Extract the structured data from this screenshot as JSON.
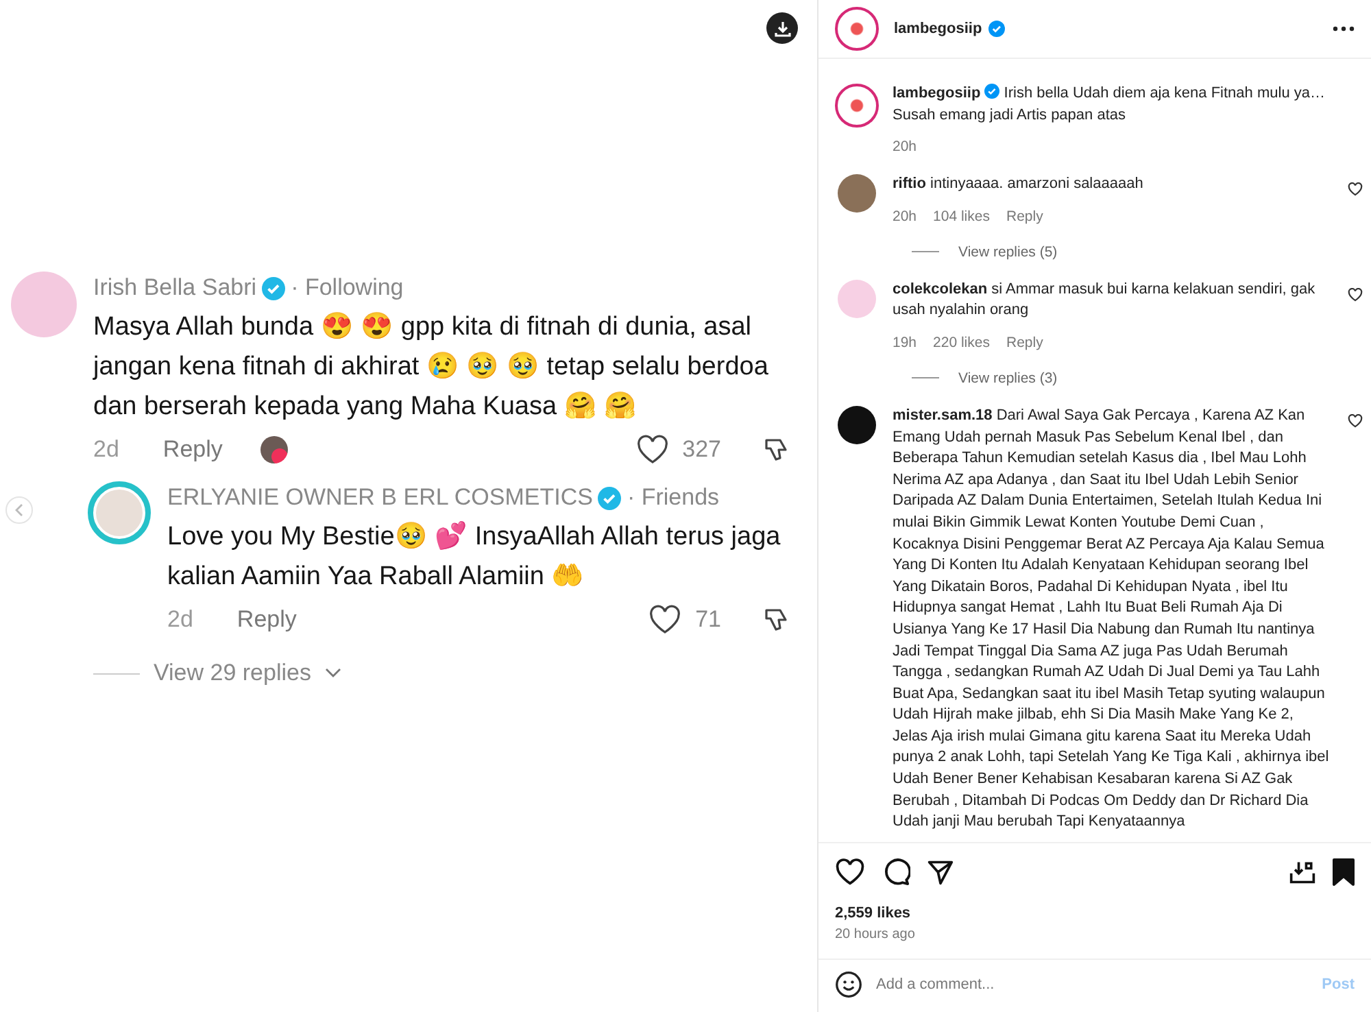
{
  "media": {
    "comments": [
      {
        "kind": "comment",
        "author": "Irish Bella Sabri",
        "relation": "· Following",
        "text": "Masya Allah bunda 😍 😍 gpp kita di fitnah di dunia, asal jangan kena fitnah di akhirat 😢 🥹 🥹 tetap selalu berdoa dan berserah kepada yang Maha Kuasa 🤗 🤗",
        "time": "2d",
        "reply": "Reply",
        "likes": "327"
      },
      {
        "kind": "reply",
        "author": "ERLYANIE OWNER B ERL COSMETICS",
        "relation": "· Friends",
        "text": "Love you My Bestie🥹 💕 InsyaAllah Allah terus jaga kalian Aamiin Yaa Raball Alamiin 🤲",
        "time": "2d",
        "reply": "Reply",
        "likes": "71"
      }
    ],
    "view_replies": "View 29 replies"
  },
  "post": {
    "username": "lambegosiip",
    "caption": {
      "username": "lambegosiip",
      "text": "Irish bella Udah diem aja kena Fitnah mulu ya… Susah emang jadi Artis papan atas",
      "time": "20h"
    },
    "comments": [
      {
        "username": "riftio",
        "text": "intinyaaaa. amarzoni salaaaaah",
        "time": "20h",
        "likes": "104 likes",
        "reply": "Reply",
        "view_replies": "View replies (5)"
      },
      {
        "username": "colekcolekan",
        "text": "si Ammar masuk bui karna kelakuan sendiri, gak usah nyalahin orang",
        "time": "19h",
        "likes": "220 likes",
        "reply": "Reply",
        "view_replies": "View replies (3)"
      },
      {
        "username": "mister.sam.18",
        "text": "Dari Awal Saya Gak Percaya , Karena AZ Kan Emang Udah pernah Masuk Pas Sebelum Kenal Ibel , dan Beberapa Tahun Kemudian setelah Kasus dia , Ibel Mau Lohh Nerima AZ apa Adanya , dan Saat itu Ibel Udah Lebih Senior Daripada AZ Dalam Dunia Entertaimen, Setelah Itulah Kedua Ini mulai Bikin Gimmik Lewat Konten Youtube Demi Cuan , Kocaknya Disini Penggemar Berat AZ Percaya Aja Kalau Semua Yang Di Konten Itu Adalah Kenyataan Kehidupan seorang Ibel Yang Dikatain Boros, Padahal Di Kehidupan Nyata , ibel Itu Hidupnya sangat Hemat , Lahh Itu Buat Beli Rumah Aja Di Usianya Yang Ke 17 Hasil Dia Nabung dan Rumah Itu nantinya Jadi Tempat Tinggal Dia Sama AZ juga Pas Udah Berumah Tangga , sedangkan Rumah AZ Udah Di Jual Demi ya Tau Lahh Buat Apa, Sedangkan saat itu ibel Masih Tetap syuting walaupun Udah Hijrah make jilbab, ehh Si Dia Masih Make Yang Ke 2, Jelas Aja irish mulai Gimana gitu karena Saat itu Mereka Udah punya 2 anak Lohh, tapi Setelah Yang Ke Tiga Kali , akhirnya ibel Udah Bener Bener Kehabisan Kesabaran karena Si AZ Gak Berubah , Ditambah Di Podcas Om Deddy dan Dr Richard Dia Udah janji Mau berubah Tapi Kenyataannya"
      }
    ],
    "saved": true,
    "likes": "2,559 likes",
    "time_ago": "20 hours ago",
    "comment_field": {
      "placeholder": "Add a comment..."
    },
    "post_button": "Post"
  }
}
